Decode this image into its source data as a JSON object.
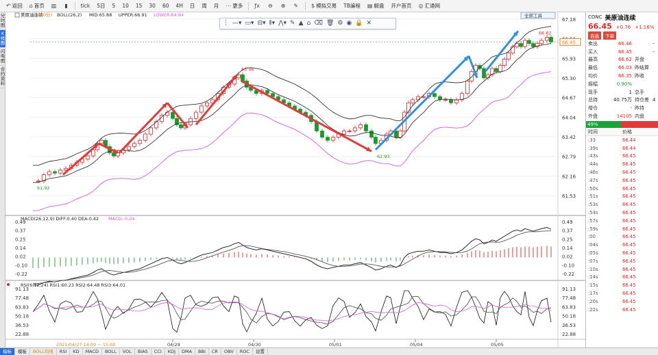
{
  "toolbar": {
    "items": [
      {
        "icon": "back-icon",
        "glyph": "↶",
        "label": "返回"
      },
      {
        "icon": "home-icon",
        "glyph": "⌂",
        "label": "首页"
      },
      {
        "icon": "kline-icon",
        "glyph": "▥",
        "label": ""
      },
      {
        "icon": "bars-icon",
        "glyph": "▮",
        "label": ""
      },
      {
        "icon": "tick-icon",
        "glyph": "",
        "label": "tick"
      },
      {
        "icon": "",
        "glyph": "",
        "label": "5日"
      },
      {
        "icon": "",
        "glyph": "",
        "label": "5"
      },
      {
        "icon": "",
        "glyph": "",
        "label": "10"
      },
      {
        "icon": "",
        "glyph": "",
        "label": "15"
      },
      {
        "icon": "",
        "glyph": "",
        "label": "30"
      },
      {
        "icon": "",
        "glyph": "",
        "label": "60"
      },
      {
        "icon": "",
        "glyph": "",
        "label": "4H"
      },
      {
        "icon": "",
        "glyph": "",
        "label": "日"
      },
      {
        "icon": "",
        "glyph": "",
        "label": "周"
      },
      {
        "icon": "",
        "glyph": "",
        "label": "月"
      },
      {
        "icon": "more-icon",
        "glyph": "⋯",
        "label": "更多"
      },
      {
        "icon": "function-icon",
        "glyph": "ƒx",
        "label": ""
      },
      {
        "icon": "zoom-out-icon",
        "glyph": "⊖",
        "label": ""
      },
      {
        "icon": "zoom-in-icon",
        "glyph": "⊕",
        "label": ""
      },
      {
        "icon": "pencil-icon",
        "glyph": "✎",
        "label": ""
      },
      {
        "icon": "dollar-icon",
        "glyph": "$",
        "label": "模拟交易"
      },
      {
        "icon": "",
        "glyph": "",
        "label": "TB编程"
      },
      {
        "icon": "book-icon",
        "glyph": "▤",
        "label": "解盘"
      },
      {
        "icon": "",
        "glyph": "",
        "label": "开户首页"
      },
      {
        "icon": "globe-icon",
        "glyph": "◎",
        "label": "汇通网"
      }
    ]
  },
  "left_tabs": [
    "分时图",
    "K线图",
    "闪电图",
    "合约资料"
  ],
  "left_tab_active": 1,
  "main_chart": {
    "title": "美原油连续",
    "period": "(60分)",
    "boll_label": "BOLL(26,2)",
    "mid_label": "MID:65.88",
    "upper_label": "UPPER:66.91",
    "lower_label": "LOWER:64.84",
    "y_ticks": [
      "67.18",
      "66.56",
      "65.93",
      "65.30",
      "64.67",
      "64.04",
      "63.42",
      "62.79",
      "62.16",
      "61.53"
    ],
    "current_price_tag": "66.45",
    "annotations": {
      "high1": "65.46",
      "low1": "61.92",
      "low2": "62.93",
      "high2": "66.62"
    },
    "corner_button": "全部工具"
  },
  "drawing_toolbar": {
    "tools": [
      "line-tool-icon",
      "rect-tool-icon",
      "channel-tool-icon",
      "fib-tool-icon",
      "wave-tool-icon",
      "pen-tool-icon",
      "marker-tool-icon",
      "stamp-tool-icon",
      "eraser-tool-icon",
      "trash-icon",
      "settings-icon",
      "eye-icon",
      "lock-icon",
      "close-icon"
    ]
  },
  "macd_panel": {
    "label": "MACD(26,12,9)",
    "diff": "DIFF:0.40",
    "dea": "DEA:0.42",
    "macd": "MACD:-0.04",
    "y_ticks": [
      "0.49",
      "0.37",
      "0.25",
      "0.14",
      "0.02",
      "-0.10",
      "-0.22"
    ]
  },
  "rsi_panel": {
    "label": "RSI(6,12,24)",
    "rsi1": "RSI1:60.23",
    "rsi2": "RSI2:64.48",
    "rsi3": "RSI3:64.01",
    "y_ticks": [
      "91.13",
      "77.48",
      "63.83",
      "50.18",
      "36.53",
      "22.88"
    ]
  },
  "x_axis": {
    "cursor_time": "2021/04/27 14:00 ~ 15:00",
    "date_labels": [
      "04/29",
      "04/30",
      "05/01",
      "05/04",
      "05/05"
    ]
  },
  "quote_panel": {
    "code": "CONC",
    "name": "美原油连续",
    "price": "66.45",
    "change": "+0.76",
    "change_pct": "+1.16%",
    "buttons": [
      "自选",
      "下单"
    ],
    "rows": [
      {
        "k": "卖出",
        "v": "66.46",
        "vc": "red",
        "k2": "",
        "v2": "-"
      },
      {
        "k": "买入",
        "v": "66.45",
        "vc": "red",
        "k2": "",
        "v2": "-"
      },
      {
        "k": "最高",
        "v": "66.62",
        "vc": "red",
        "k2": "开盘",
        "v2": ""
      },
      {
        "k": "最低",
        "v": "66.03",
        "vc": "red",
        "k2": "昨结算",
        "v2": ""
      },
      {
        "k": "均价",
        "v": "66.35",
        "vc": "red",
        "k2": "昨收",
        "v2": ""
      },
      {
        "k": "振幅",
        "v": "0.90%",
        "vc": "green",
        "k2": "",
        "v2": ""
      },
      {
        "k": "现手",
        "v": "1",
        "vc": "",
        "k2": "总手",
        "v2": ""
      },
      {
        "k": "总持",
        "v": "40.75万",
        "vc": "",
        "k2": "持仓差",
        "v2": "4"
      },
      {
        "k": "增仓",
        "v": "-",
        "vc": "",
        "k2": "昨持",
        "v2": ""
      },
      {
        "k": "外盘",
        "v": "14105",
        "vc": "red",
        "k2": "内盘",
        "v2": ""
      }
    ],
    "ratio_label": "49%",
    "ticks_head": [
      "时间",
      "价格"
    ],
    "ticks": [
      {
        "t": ":33",
        "p": "66.44"
      },
      {
        "t": ":39s",
        "p": "66.44"
      },
      {
        "t": ":43s",
        "p": "66.45"
      },
      {
        "t": ":44s",
        "p": "66.45"
      },
      {
        "t": ":46s",
        "p": "66.45"
      },
      {
        "t": ":47s",
        "p": "66.45"
      },
      {
        "t": ":50s",
        "p": "66.45"
      },
      {
        "t": ":51s",
        "p": "66.45"
      },
      {
        "t": ":53s",
        "p": "66.45"
      },
      {
        "t": ":54s",
        "p": "66.45"
      },
      {
        "t": ":57s",
        "p": "66.45"
      },
      {
        "t": ":59s",
        "p": "66.45"
      },
      {
        "t": ":00",
        "p": "66.45"
      },
      {
        "t": ":04s",
        "p": "66.45"
      },
      {
        "t": ":05s",
        "p": "66.45"
      },
      {
        "t": ":07s",
        "p": "66.45"
      },
      {
        "t": ":10s",
        "p": "66.45"
      },
      {
        "t": ":14s",
        "p": "66.45"
      },
      {
        "t": ":15s",
        "p": "66.45"
      },
      {
        "t": ":17s",
        "p": "66.45"
      },
      {
        "t": ":20s",
        "p": "66.45"
      },
      {
        "t": ":22s",
        "p": "66.45"
      }
    ]
  },
  "status_bar": {
    "items": [
      "指标",
      "模板",
      "BOLL均线",
      "RSI",
      "KD",
      "MACD",
      "BOLL",
      "VOL",
      "BIAS",
      "CCI",
      "KDJ",
      "DMA",
      "BBI",
      "CR",
      "OBV",
      "ROC",
      "设置"
    ],
    "active": 0
  },
  "colors": {
    "up": "#e02424",
    "down": "#1a9a2a",
    "up_arrow": "#e23a3a",
    "blue_arrow": "#2f8fe0",
    "boll_lower": "#d85ad8",
    "accent": "#2b6cd8"
  }
}
